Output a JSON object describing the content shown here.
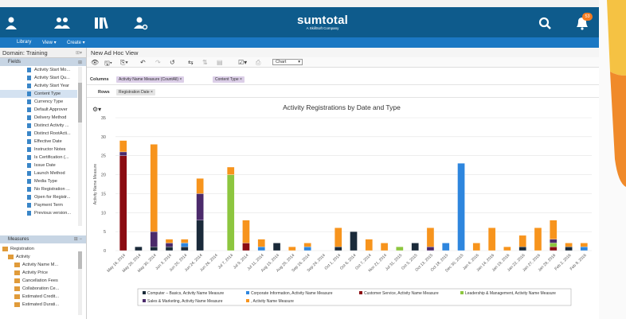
{
  "menubar": {
    "library": "Library",
    "view": "View",
    "create": "Create"
  },
  "logo": {
    "name": "sumtotal",
    "sub": "A SkillSoft Company"
  },
  "notification_count": "53",
  "left_panel": {
    "domain_label": "Domain: Training",
    "fields_label": "Fields",
    "fields": [
      "Activity Start Mo...",
      "Activity Start Qu...",
      "Activity Start Year",
      "Content Type",
      "Currency Type",
      "Default Approver",
      "Delivery Method",
      "Distinct Activity ...",
      "Distinct RootActi...",
      "Effective Date",
      "Instructor Notes",
      "Is Certification (...",
      "Issue Date",
      "Launch Method",
      "Media Type",
      "No Registration ...",
      "Open for Registr...",
      "Payment Term",
      "Previous version..."
    ],
    "measures_label": "Measures",
    "measures_root": "Registration",
    "measures_group": "Activity",
    "measures": [
      "Activity Name M...",
      "Activity Price",
      "Cancellation Fees",
      "Collaboration Ce...",
      "Estimated Credit...",
      "Estimated Durati..."
    ]
  },
  "main": {
    "view_title": "New Ad Hoc View",
    "chart_select": "Chart",
    "columns_label": "Columns",
    "rows_label": "Rows",
    "columns_pills": [
      "Activity Name Measure (CountAll)",
      "Content Type"
    ],
    "rows_pills": [
      "Registration Date"
    ]
  },
  "colors": {
    "topbar": "#0e5b8c",
    "menubar": "#1b78c3",
    "computer": "#1a2a3a",
    "corporate": "#2e86de",
    "customer": "#8b0c12",
    "leadership": "#8dc63f",
    "sales": "#4b2a6b",
    "blank": "#f7941d"
  },
  "chart_data": {
    "type": "bar",
    "stacked": true,
    "title": "Activity Registrations by Date and Type",
    "ylabel": "Activity Name Measure",
    "xlabel": "",
    "ylim": [
      0,
      35
    ],
    "yticks": [
      0,
      5,
      10,
      15,
      20,
      25,
      30,
      35
    ],
    "grid": true,
    "legend_position": "bottom",
    "categories": [
      "May 16, 2014",
      "May 29, 2014",
      "May 30, 2014",
      "Jun 3, 2014",
      "Jun 20, 2014",
      "Jun 24, 2014",
      "Jun 26, 2014",
      "Jul 7, 2014",
      "Jul 9, 2014",
      "Jul 11, 2014",
      "Aug 15, 2014",
      "Aug 25, 2014",
      "Sep 16, 2014",
      "Sep 24, 2014",
      "Oct 1, 2014",
      "Oct 6, 2014",
      "Oct 7, 2014",
      "Nov 21, 2014",
      "Jul 31, 2015",
      "Oct 5, 2015",
      "Oct 13, 2015",
      "Oct 18, 2015",
      "Dec 30, 2015",
      "Jan 4, 2016",
      "Jan 14, 2016",
      "Jan 19, 2016",
      "Jan 22, 2016",
      "Jan 27, 2016",
      "Jan 29, 2016",
      "Feb 2, 2016",
      "Feb 8, 2016"
    ],
    "series": [
      {
        "name": "Computer – Basics, Activity Name Measure",
        "color": "#1a2a3a",
        "values": [
          0,
          1,
          1,
          1,
          1,
          8,
          0,
          0,
          0,
          0,
          2,
          0,
          0,
          0,
          1,
          5,
          0,
          0,
          0,
          2,
          0,
          0,
          0,
          0,
          0,
          0,
          1,
          0,
          0,
          1,
          0
        ]
      },
      {
        "name": "Corporate Information, Activity Name Measure",
        "color": "#2e86de",
        "values": [
          0,
          0,
          0,
          0,
          1,
          0,
          0,
          0,
          0,
          1,
          0,
          0,
          1,
          0,
          0,
          0,
          0,
          0,
          0,
          0,
          0,
          2,
          23,
          0,
          0,
          0,
          0,
          0,
          0,
          0,
          1
        ]
      },
      {
        "name": "Customer Service, Activity Name Measure",
        "color": "#8b0c12",
        "values": [
          25,
          0,
          0,
          0,
          0,
          0,
          0,
          0,
          2,
          0,
          0,
          0,
          0,
          0,
          0,
          0,
          0,
          0,
          0,
          0,
          0,
          0,
          0,
          0,
          0,
          0,
          0,
          0,
          1,
          0,
          0
        ]
      },
      {
        "name": "Leadership & Management, Activity Name Measure",
        "color": "#8dc63f",
        "values": [
          0,
          0,
          0,
          0,
          0,
          0,
          0,
          20,
          0,
          0,
          0,
          0,
          0,
          0,
          0,
          0,
          0,
          0,
          1,
          0,
          0,
          0,
          0,
          0,
          0,
          0,
          0,
          0,
          1,
          0,
          0
        ]
      },
      {
        "name": "Sales & Marketing, Activity Name Measure",
        "color": "#4b2a6b",
        "values": [
          1,
          0,
          4,
          1,
          0,
          7,
          0,
          0,
          0,
          0,
          0,
          0,
          0,
          0,
          0,
          0,
          0,
          0,
          0,
          0,
          1,
          0,
          0,
          0,
          0,
          0,
          0,
          0,
          1,
          0,
          0
        ]
      },
      {
        "name": ", Activity Name Measure",
        "color": "#f7941d",
        "values": [
          3,
          0,
          23,
          1,
          1,
          4,
          0,
          2,
          6,
          2,
          0,
          1,
          1,
          0,
          5,
          0,
          3,
          2,
          0,
          0,
          5,
          0,
          0,
          2,
          6,
          1,
          3,
          6,
          5,
          1,
          1
        ]
      }
    ]
  }
}
